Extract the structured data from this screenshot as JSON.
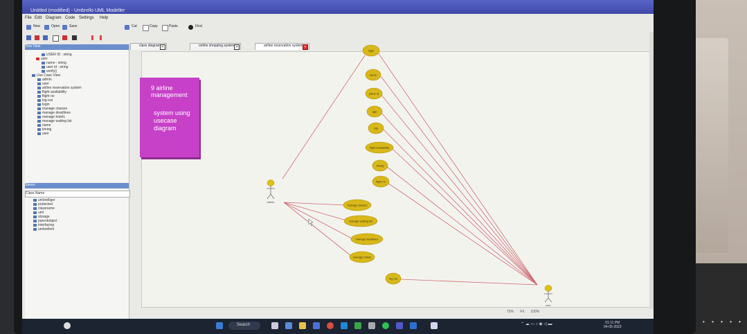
{
  "window": {
    "title": "Untitled (modified) - Umbrello UML Modeller"
  },
  "menu": [
    "File",
    "Edit",
    "Diagram",
    "Code",
    "Settings",
    "Help"
  ],
  "toolbar": [
    "New",
    "Open",
    "Save",
    "Cut",
    "Copy",
    "Paste",
    "Find"
  ],
  "tree_view": {
    "header": "Tree View",
    "items": [
      "USER ID : string",
      "user",
      "name : string",
      "user id : string",
      "verify()",
      "Use Case View",
      "admin",
      "user",
      "airline reservation system",
      "flight availability",
      "flight no",
      "log out",
      "login",
      "manage classes",
      "manage deadlines",
      "manage hotels",
      "manage waiting list",
      "name",
      "timing",
      "user"
    ]
  },
  "second_panel": {
    "header": "Stereo",
    "subheader": "Class Name",
    "items": [
      "umbrelliger",
      "protected",
      "classname",
      "uml",
      "storage",
      "parentobject",
      "interfacing",
      "umbrellerk"
    ]
  },
  "tabs": [
    {
      "label": "class diagram",
      "active": false
    },
    {
      "label": "online shopping system",
      "active": false
    },
    {
      "label": "airline reservation system",
      "active": true
    }
  ],
  "note": {
    "line1": "9 airline management",
    "line2": "system using usecase diagram"
  },
  "use_cases": {
    "login": "login",
    "name": "name",
    "planeid": "plane id",
    "age": "age",
    "city": "city",
    "flight_availability": "flight availability",
    "timing": "timing",
    "flight_no": "flight no",
    "manage_classes": "manage classes",
    "manage_waiting_list": "manage waiting list",
    "manage_deadlines": "manage deadlines",
    "manage_hotels": "manage hotels",
    "log_out": "log out"
  },
  "actors": {
    "admin": "admin",
    "user": "user"
  },
  "status": {
    "zoom": "75%",
    "fit": "Fit",
    "full": "100%"
  },
  "taskbar": {
    "search": "Search",
    "time": "01:11 PM",
    "date": "04-05-2023"
  },
  "colors": {
    "note": "#c740c8",
    "usecase": "#d8b81a",
    "association": "#d06a72",
    "titlebar": "#4a55b8"
  }
}
